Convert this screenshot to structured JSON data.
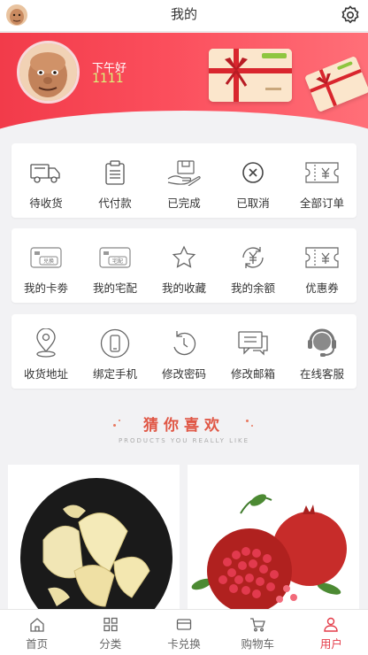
{
  "header": {
    "title": "我的"
  },
  "user": {
    "greeting": "下午好",
    "name": "1111"
  },
  "orders": [
    {
      "label": "待收货",
      "icon": "truck-icon"
    },
    {
      "label": "代付款",
      "icon": "clipboard-icon"
    },
    {
      "label": "已完成",
      "icon": "box-hand-icon"
    },
    {
      "label": "已取消",
      "icon": "cancel-circle-icon"
    },
    {
      "label": "全部订单",
      "icon": "ticket-yen-icon"
    }
  ],
  "assets": [
    {
      "label": "我的卡劵",
      "icon": "card-exchange-icon",
      "badge": "兑换"
    },
    {
      "label": "我的宅配",
      "icon": "card-delivery-icon",
      "badge": "宅配"
    },
    {
      "label": "我的收藏",
      "icon": "star-icon"
    },
    {
      "label": "我的余额",
      "icon": "yen-cycle-icon"
    },
    {
      "label": "优惠券",
      "icon": "coupon-yen-icon"
    }
  ],
  "services": [
    {
      "label": "收货地址",
      "icon": "location-pin-icon"
    },
    {
      "label": "绑定手机",
      "icon": "phone-icon"
    },
    {
      "label": "修改密码",
      "icon": "refresh-lock-icon"
    },
    {
      "label": "修改邮箱",
      "icon": "message-icon"
    },
    {
      "label": "在线客服",
      "icon": "headset-icon"
    }
  ],
  "recommend": {
    "title": "猜你喜欢",
    "subtitle": "PRODUCTS YOU REALLY LIKE"
  },
  "products": [
    {
      "name": "pomelo",
      "image": "pomelo-photo"
    },
    {
      "name": "pomegranate",
      "image": "pomegranate-photo"
    }
  ],
  "tabs": [
    {
      "label": "首页",
      "icon": "home-icon",
      "active": false
    },
    {
      "label": "分类",
      "icon": "grid-icon",
      "active": false
    },
    {
      "label": "卡兑换",
      "icon": "card-icon",
      "active": false
    },
    {
      "label": "购物车",
      "icon": "cart-icon",
      "active": false
    },
    {
      "label": "用户",
      "icon": "user-icon",
      "active": true
    }
  ],
  "colors": {
    "accent": "#e43b48",
    "hero_start": "#f23b4a",
    "hero_end": "#ff6f78",
    "name_color": "#d9f57a",
    "recommend_title": "#e05745"
  }
}
